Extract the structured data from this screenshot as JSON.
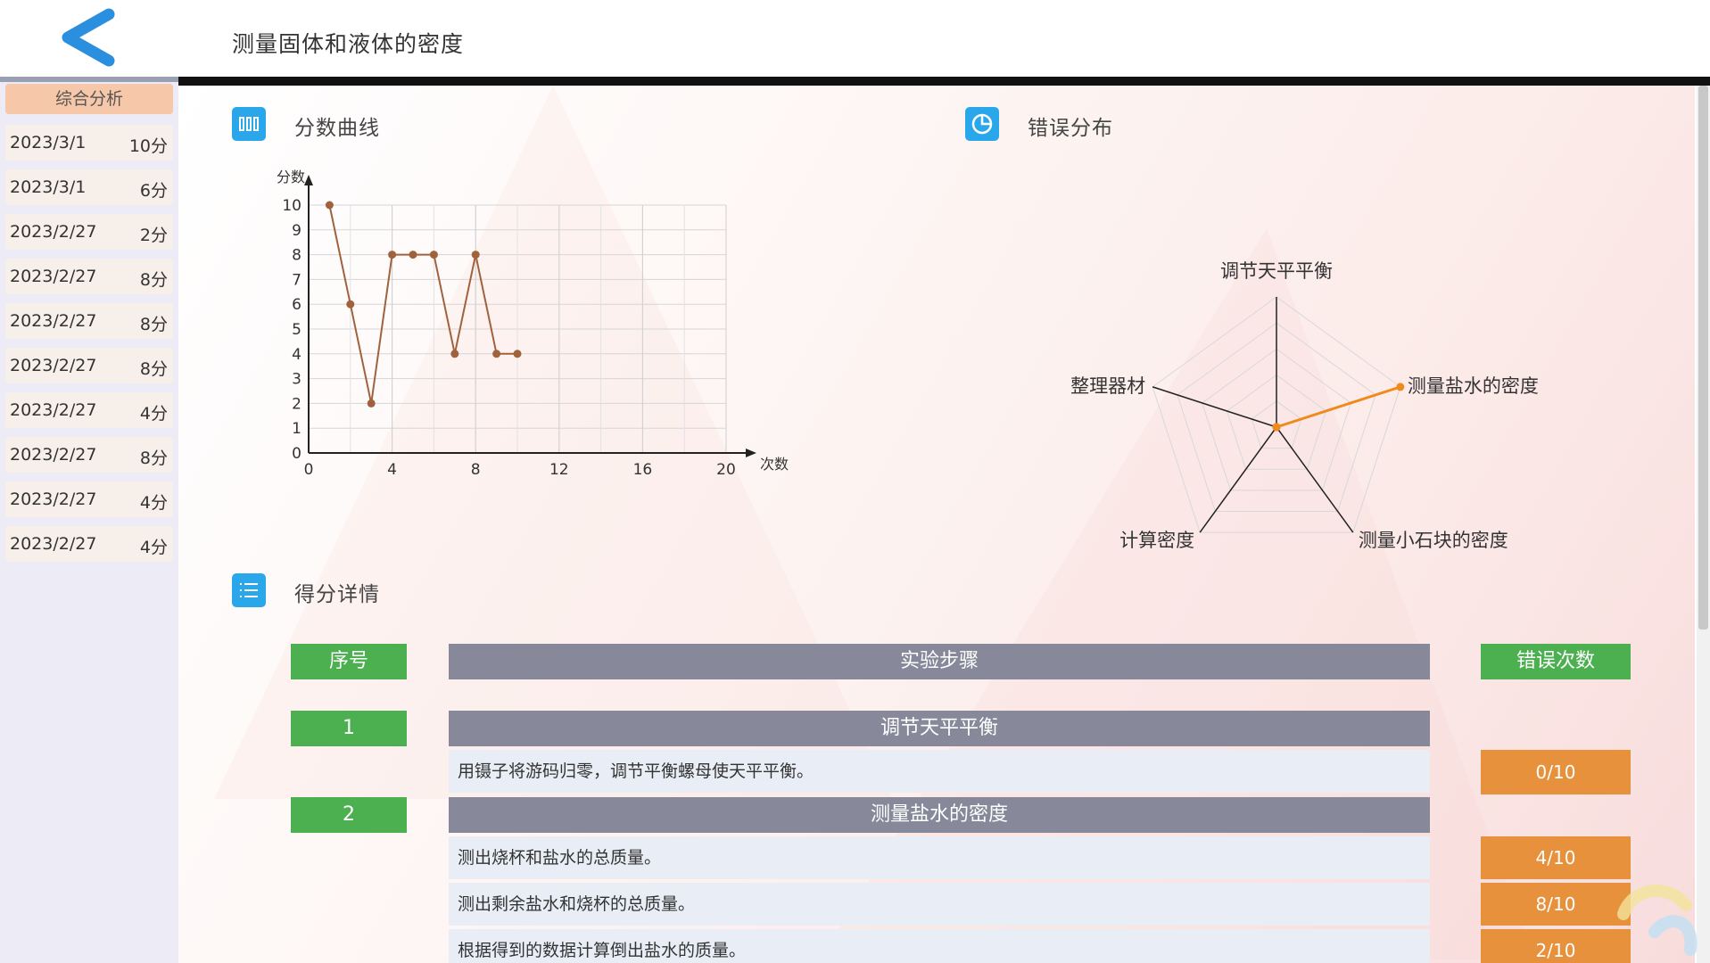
{
  "header": {
    "title": "测量固体和液体的密度"
  },
  "sidebar": {
    "header": "综合分析",
    "items": [
      {
        "date": "2023/3/1",
        "score": "10分"
      },
      {
        "date": "2023/3/1",
        "score": "6分"
      },
      {
        "date": "2023/2/27",
        "score": "2分"
      },
      {
        "date": "2023/2/27",
        "score": "8分"
      },
      {
        "date": "2023/2/27",
        "score": "8分"
      },
      {
        "date": "2023/2/27",
        "score": "8分"
      },
      {
        "date": "2023/2/27",
        "score": "4分"
      },
      {
        "date": "2023/2/27",
        "score": "8分"
      },
      {
        "date": "2023/2/27",
        "score": "4分"
      },
      {
        "date": "2023/2/27",
        "score": "4分"
      }
    ]
  },
  "sections": {
    "score_curve": "分数曲线",
    "error_dist": "错误分布",
    "detail": "得分详情"
  },
  "chart_data": [
    {
      "type": "line",
      "xlabel": "次数",
      "ylabel": "分数",
      "xlim": [
        0,
        20
      ],
      "ylim": [
        0,
        10
      ],
      "x_ticks": [
        "0",
        "4",
        "8",
        "12",
        "16",
        "20"
      ],
      "y_ticks": [
        "0",
        "1",
        "2",
        "3",
        "4",
        "5",
        "6",
        "7",
        "8",
        "9",
        "10"
      ],
      "grid": true,
      "series": [
        {
          "x": [
            1,
            2,
            3,
            4,
            5,
            6,
            7,
            8,
            9,
            10
          ],
          "values": [
            10,
            6,
            2,
            8,
            8,
            8,
            4,
            8,
            4,
            4
          ],
          "color": "#a0623d"
        }
      ]
    },
    {
      "type": "radar",
      "categories": [
        "调节天平平衡",
        "测量盐水的密度",
        "测量小石块的密度",
        "计算密度",
        "整理器材"
      ],
      "series": [
        {
          "values": [
            0,
            1,
            0,
            0,
            0
          ],
          "color": "#f08a1c"
        }
      ],
      "max": 1
    }
  ],
  "table": {
    "headers": {
      "index": "序号",
      "step": "实验步骤",
      "errors": "错误次数"
    },
    "groups": [
      {
        "index": "1",
        "title": "调节天平平衡",
        "rows": [
          {
            "text": "用镊子将游码归零，调节平衡螺母使天平平衡。",
            "count": "0/10"
          }
        ]
      },
      {
        "index": "2",
        "title": "测量盐水的密度",
        "rows": [
          {
            "text": "测出烧杯和盐水的总质量。",
            "count": "4/10"
          },
          {
            "text": "测出剩余盐水和烧杯的总质量。",
            "count": "8/10"
          },
          {
            "text": "根据得到的数据计算倒出盐水的质量。",
            "count": "2/10"
          }
        ]
      }
    ]
  },
  "colors": {
    "accent_blue": "#2aa7ea",
    "green": "#4caf50",
    "orange": "#e8913d",
    "grey": "#878899"
  }
}
